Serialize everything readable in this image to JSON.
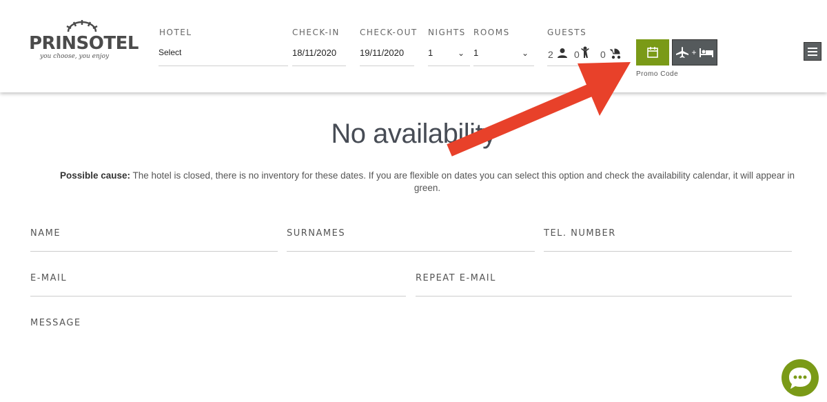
{
  "header": {
    "logo": {
      "brand": "PRINSOTEL",
      "slogan": "you choose, you enjoy"
    },
    "fields": {
      "hotel": {
        "label": "HOTEL",
        "value": "Select"
      },
      "checkin": {
        "label": "CHECK-IN",
        "value": "18/11/2020"
      },
      "checkout": {
        "label": "CHECK-OUT",
        "value": "19/11/2020"
      },
      "nights": {
        "label": "NIGHTS",
        "value": "1"
      },
      "rooms": {
        "label": "ROOMS",
        "value": "1"
      },
      "guests": {
        "label": "GUESTS",
        "adults": "2",
        "children": "0",
        "babies": "0"
      }
    },
    "buttons": {
      "flight_plus": "+"
    },
    "promo_code": "Promo Code",
    "colors": {
      "accent": "#7a9a17",
      "dark": "#555a5c",
      "arrow": "#e8412a"
    }
  },
  "main": {
    "title": "No availability",
    "cause_label": "Possible cause:",
    "cause_text": " The hotel is closed, there is no inventory for these dates. If you are flexible on dates you can select this option and check the availability calendar, it will appear in green."
  },
  "form": {
    "name": "NAME",
    "surnames": "SURNAMES",
    "tel": "TEL. NUMBER",
    "email": "E-MAIL",
    "repeat_email": "REPEAT E-MAIL",
    "message": "MESSAGE"
  },
  "icons": {
    "menu": "menu-icon",
    "calendar": "calendar-icon",
    "flight": "airplane-icon",
    "bed": "bed-icon",
    "chat": "chat-icon"
  }
}
